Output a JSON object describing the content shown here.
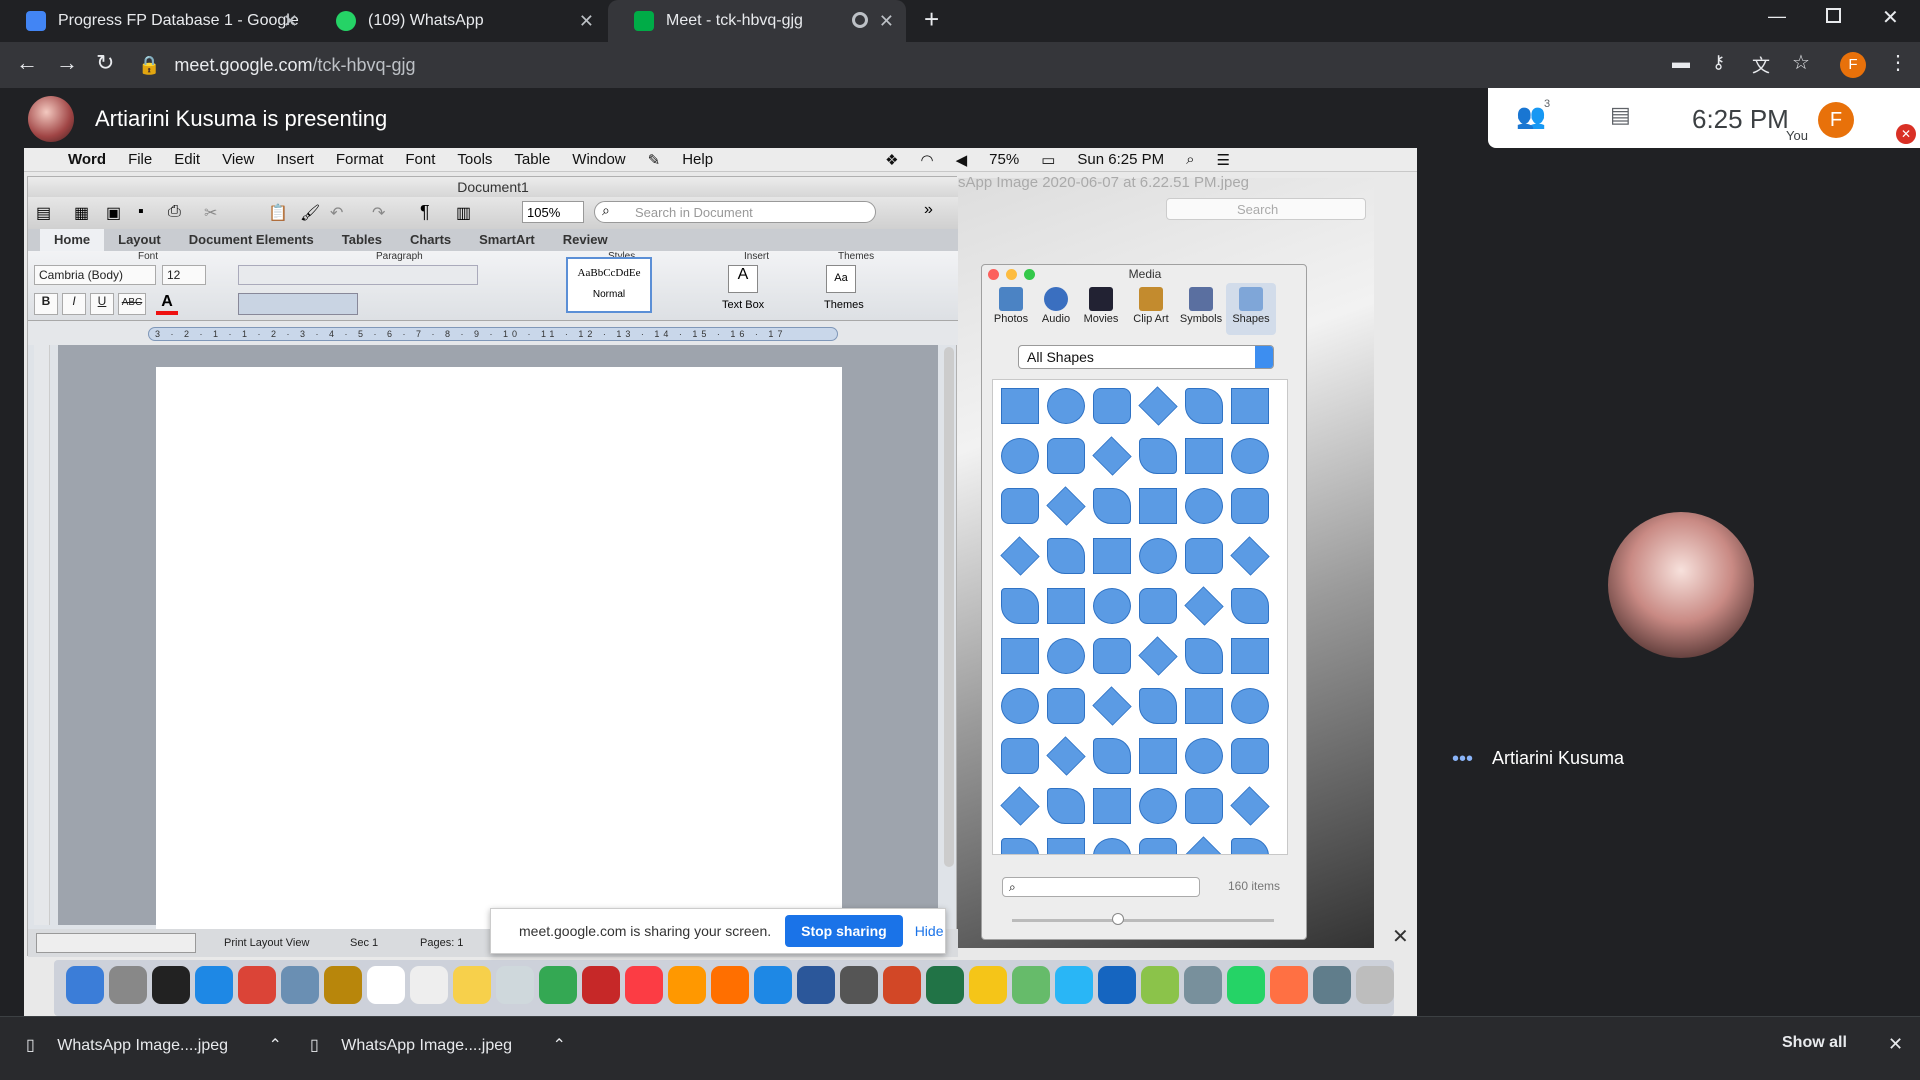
{
  "tabs": [
    {
      "title": "Progress FP Database 1 - Google",
      "icon": "google-docs-icon",
      "color": "#4285f4"
    },
    {
      "title": "(109) WhatsApp",
      "icon": "whatsapp-icon",
      "color": "#25d366"
    },
    {
      "title": "Meet - tck-hbvq-gjg",
      "icon": "meet-icon",
      "color": "#00ac47"
    }
  ],
  "omnibox": {
    "host": "meet.google.com",
    "path": "/tck-hbvq-gjg"
  },
  "profile_initial": "F",
  "meet": {
    "presenting": "Artiarini Kusuma is presenting",
    "participants_count": "3",
    "time": "6:25 PM",
    "you_label": "You",
    "self_name": "Artiarini Kusuma"
  },
  "mac_menu": {
    "items": [
      "Word",
      "File",
      "Edit",
      "View",
      "Insert",
      "Format",
      "Font",
      "Tools",
      "Table",
      "Window",
      "Help"
    ],
    "battery": "75%",
    "clock": "Sun 6:25 PM"
  },
  "word": {
    "title": "Document1",
    "zoom": "105%",
    "search_placeholder": "Search in Document",
    "ribbon_tabs": [
      "Home",
      "Layout",
      "Document Elements",
      "Tables",
      "Charts",
      "SmartArt",
      "Review"
    ],
    "group_labels": {
      "font": "Font",
      "paragraph": "Paragraph",
      "styles": "Styles",
      "insert": "Insert",
      "themes": "Themes"
    },
    "font_name": "Cambria (Body)",
    "font_size": "12",
    "style_preview": "AaBbCcDdEe",
    "style_name": "Normal",
    "text_box": "Text Box",
    "themes": "Themes",
    "ruler_text": "3 · 2 · 1 · 1 · 2 · 3 · 4 · 5 · 6 · 7 · 8 · 9 · 10 · 11 · 12 · 13 · 14 · 15 · 16 · 17",
    "status": {
      "view": "Print Layout View",
      "sec": "Sec 1",
      "pages": "Pages: 1"
    }
  },
  "bg_window_title": "sApp Image 2020-06-07 at 6.22.51 PM.jpeg",
  "bg_search": "Search",
  "media": {
    "title": "Media",
    "tabs": [
      {
        "label": "Photos",
        "color": "#4b83c4"
      },
      {
        "label": "Audio",
        "color": "#3a6fc0"
      },
      {
        "label": "Movies",
        "color": "#223"
      },
      {
        "label": "Clip Art",
        "color": "#c38b2e"
      },
      {
        "label": "Symbols",
        "color": "#5a6fa0"
      },
      {
        "label": "Shapes",
        "color": "#7fa6d8"
      }
    ],
    "filter": "All Shapes",
    "count": "160 items"
  },
  "notification": {
    "message": "meet.google.com is sharing your screen.",
    "stop": "Stop sharing",
    "hide": "Hide"
  },
  "downloads": [
    {
      "name": "WhatsApp Image....jpeg"
    },
    {
      "name": "WhatsApp Image....jpeg"
    }
  ],
  "show_all": "Show all"
}
